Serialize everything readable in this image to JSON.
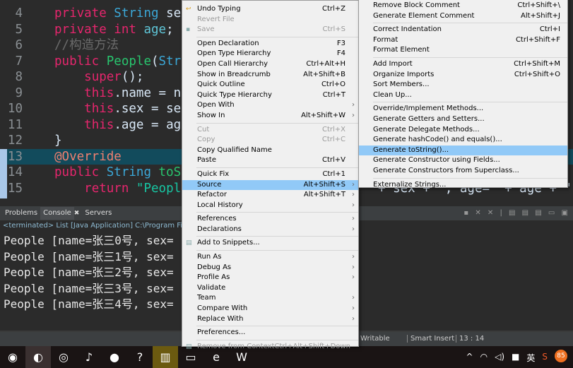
{
  "editor": {
    "lines": [
      {
        "n": "4",
        "html": [
          [
            "k",
            "private "
          ],
          [
            "t",
            "String "
          ],
          [
            "",
            "sex;"
          ]
        ]
      },
      {
        "n": "5",
        "html": [
          [
            "k",
            "private "
          ],
          [
            "k",
            "int "
          ],
          [
            "f",
            "age"
          ],
          [
            "",
            ";"
          ]
        ]
      },
      {
        "n": "6",
        "html": [
          [
            "c",
            "//构造方法"
          ]
        ]
      },
      {
        "n": "7",
        "html": [
          [
            "k",
            "public "
          ],
          [
            "g",
            "People"
          ],
          [
            "",
            "("
          ],
          [
            "t",
            "Strin"
          ]
        ]
      },
      {
        "n": "8",
        "html": [
          [
            "",
            "    "
          ],
          [
            "k",
            "super"
          ],
          [
            "",
            "();"
          ]
        ]
      },
      {
        "n": "9",
        "html": [
          [
            "",
            "    "
          ],
          [
            "k",
            "this"
          ],
          [
            "",
            ".name = nam"
          ]
        ]
      },
      {
        "n": "10",
        "html": [
          [
            "",
            "    "
          ],
          [
            "k",
            "this"
          ],
          [
            "",
            ".sex = sex;"
          ]
        ]
      },
      {
        "n": "11",
        "html": [
          [
            "",
            "    "
          ],
          [
            "k",
            "this"
          ],
          [
            "",
            ".age = age;"
          ]
        ]
      },
      {
        "n": "12",
        "html": [
          [
            "",
            "}"
          ]
        ]
      },
      {
        "n": "13",
        "html": [
          [
            "a",
            "@Override"
          ]
        ]
      },
      {
        "n": "14",
        "html": [
          [
            "k",
            "public "
          ],
          [
            "t",
            "String "
          ],
          [
            "g",
            "toStr"
          ]
        ]
      },
      {
        "n": "15",
        "html": [
          [
            "",
            "    "
          ],
          [
            "k",
            "return "
          ],
          [
            "s",
            "\"People"
          ]
        ]
      }
    ],
    "line15_tail": "+ sex + \", age=\" + age + \"]\";"
  },
  "console": {
    "tabs": [
      "Problems",
      "Console",
      "Servers"
    ],
    "active_tab": "Console",
    "terminated": "<terminated> List [Java Application] C:\\Program Files\\Java",
    "output": [
      "People [name=张三0号, sex=",
      "People [name=张三1号, sex=",
      "People [name=张三2号, sex=",
      "People [name=张三3号, sex=",
      "People [name=张三4号, sex="
    ]
  },
  "status": {
    "writable": "Writable",
    "insert": "Smart Insert",
    "position": "13 : 14"
  },
  "context_menu": [
    {
      "label": "Undo Typing",
      "key": "Ctrl+Z",
      "icon": "undo-icon"
    },
    {
      "label": "Revert File",
      "disabled": true
    },
    {
      "label": "Save",
      "key": "Ctrl+S",
      "disabled": true,
      "icon": "save-icon"
    },
    {
      "sep": true
    },
    {
      "label": "Open Declaration",
      "key": "F3"
    },
    {
      "label": "Open Type Hierarchy",
      "key": "F4"
    },
    {
      "label": "Open Call Hierarchy",
      "key": "Ctrl+Alt+H"
    },
    {
      "label": "Show in Breadcrumb",
      "key": "Alt+Shift+B"
    },
    {
      "label": "Quick Outline",
      "key": "Ctrl+O"
    },
    {
      "label": "Quick Type Hierarchy",
      "key": "Ctrl+T"
    },
    {
      "label": "Open With",
      "sub": true
    },
    {
      "label": "Show In",
      "key": "Alt+Shift+W",
      "sub": true
    },
    {
      "sep": true
    },
    {
      "label": "Cut",
      "key": "Ctrl+X",
      "disabled": true
    },
    {
      "label": "Copy",
      "key": "Ctrl+C",
      "disabled": true
    },
    {
      "label": "Copy Qualified Name"
    },
    {
      "label": "Paste",
      "key": "Ctrl+V"
    },
    {
      "sep": true
    },
    {
      "label": "Quick Fix",
      "key": "Ctrl+1"
    },
    {
      "label": "Source",
      "key": "Alt+Shift+S",
      "sub": true,
      "highlighted": true
    },
    {
      "label": "Refactor",
      "key": "Alt+Shift+T",
      "sub": true
    },
    {
      "label": "Local History",
      "sub": true
    },
    {
      "sep": true
    },
    {
      "label": "References",
      "sub": true
    },
    {
      "label": "Declarations",
      "sub": true
    },
    {
      "sep": true
    },
    {
      "label": "Add to Snippets...",
      "icon": "snippet-icon"
    },
    {
      "sep": true
    },
    {
      "label": "Run As",
      "sub": true
    },
    {
      "label": "Debug As",
      "sub": true
    },
    {
      "label": "Profile As",
      "sub": true
    },
    {
      "label": "Validate"
    },
    {
      "label": "Team",
      "sub": true
    },
    {
      "label": "Compare With",
      "sub": true
    },
    {
      "label": "Replace With",
      "sub": true
    },
    {
      "sep": true
    },
    {
      "label": "Preferences..."
    },
    {
      "sep": true
    },
    {
      "label": "Remove from Context",
      "key": "Ctrl+Alt+Shift+Down",
      "disabled": true,
      "icon": "context-icon"
    }
  ],
  "source_submenu": [
    {
      "label": "Remove Block Comment",
      "key": "Ctrl+Shift+\\"
    },
    {
      "label": "Generate Element Comment",
      "key": "Alt+Shift+J"
    },
    {
      "sep": true
    },
    {
      "label": "Correct Indentation",
      "key": "Ctrl+I"
    },
    {
      "label": "Format",
      "key": "Ctrl+Shift+F"
    },
    {
      "label": "Format Element"
    },
    {
      "sep": true
    },
    {
      "label": "Add Import",
      "key": "Ctrl+Shift+M"
    },
    {
      "label": "Organize Imports",
      "key": "Ctrl+Shift+O"
    },
    {
      "label": "Sort Members..."
    },
    {
      "label": "Clean Up..."
    },
    {
      "sep": true
    },
    {
      "label": "Override/Implement Methods..."
    },
    {
      "label": "Generate Getters and Setters..."
    },
    {
      "label": "Generate Delegate Methods..."
    },
    {
      "label": "Generate hashCode() and equals()..."
    },
    {
      "label": "Generate toString()...",
      "highlighted": true
    },
    {
      "label": "Generate Constructor using Fields..."
    },
    {
      "label": "Generate Constructors from Superclass..."
    },
    {
      "sep": true
    },
    {
      "label": "Externalize Strings..."
    }
  ],
  "taskbar": {
    "icons": [
      "qq-icon",
      "eclipse-icon",
      "chrome-icon",
      "dolphin-icon",
      "firefox-icon",
      "help-icon",
      "chart-app-icon",
      "file-explorer-icon",
      "edge-icon",
      "wps-icon"
    ],
    "tray": {
      "ime": "英",
      "badge": "85"
    }
  },
  "colors": {
    "highlight": "#91c9f7",
    "editor_bg": "#2b2b2b",
    "keyword": "#e6266d",
    "type": "#3ba8d8"
  }
}
